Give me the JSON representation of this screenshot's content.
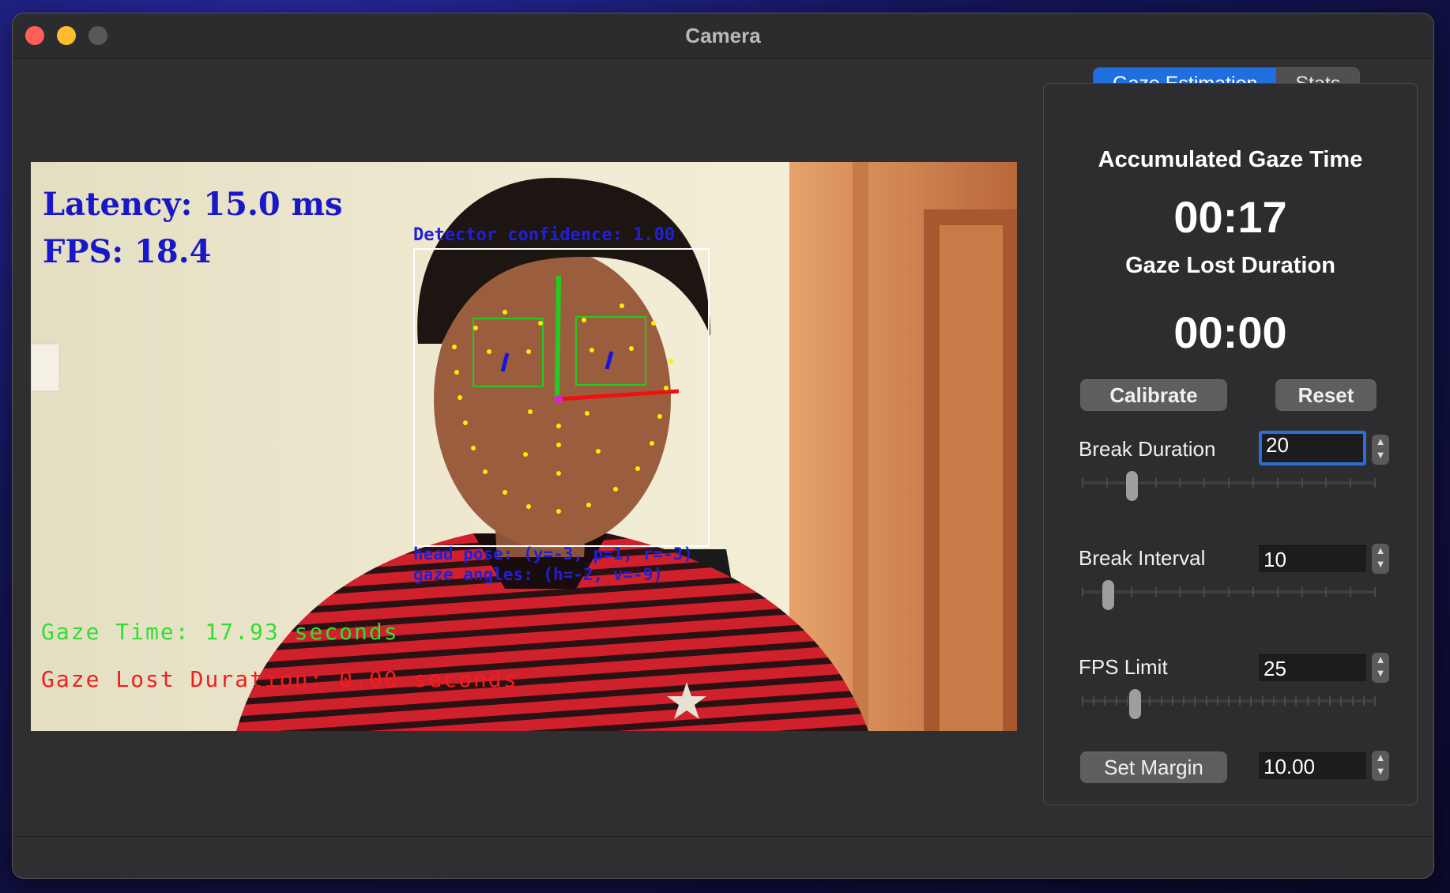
{
  "window": {
    "title": "Camera"
  },
  "camera": {
    "latency": "Latency: 15.0 ms",
    "fps": "FPS: 18.4",
    "detector_confidence": "Detector confidence: 1.00",
    "head_pose": "head pose: (y=-3, p=1, r=-3)",
    "gaze_angles": "gaze angles: (h=-2, v=-9)",
    "gaze_time": "Gaze Time: 17.93 seconds",
    "gaze_lost": "Gaze Lost Duration: 0.00 seconds"
  },
  "tabs": [
    {
      "label": "Gaze Estimation",
      "active": true
    },
    {
      "label": "Stats",
      "active": false
    }
  ],
  "gaze": {
    "accumulated_label": "Accumulated Gaze Time",
    "accumulated_value": "00:17",
    "lost_label": "Gaze Lost Duration",
    "lost_value": "00:00"
  },
  "buttons": {
    "calibrate": "Calibrate",
    "reset": "Reset",
    "set_margin": "Set Margin"
  },
  "settings": {
    "break_duration": {
      "label": "Break Duration",
      "value": "20",
      "slider_fraction": 0.17
    },
    "break_interval": {
      "label": "Break Interval",
      "value": "10",
      "slider_fraction": 0.09
    },
    "fps_limit": {
      "label": "FPS Limit",
      "value": "25",
      "slider_fraction": 0.18
    },
    "margin": {
      "value": "10.00"
    }
  },
  "colors": {
    "accent": "#1f6fe0",
    "overlay_blue": "#1818c8",
    "overlay_green": "#33dd33",
    "overlay_red": "#ee2020"
  }
}
